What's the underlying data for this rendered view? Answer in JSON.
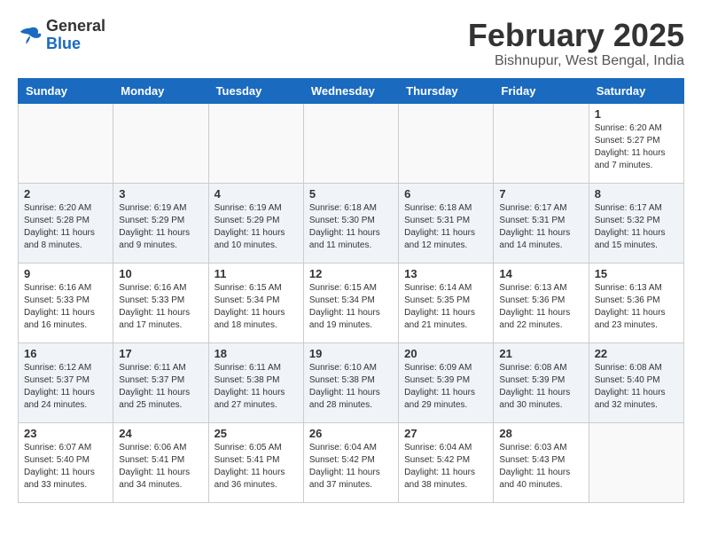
{
  "header": {
    "logo_general": "General",
    "logo_blue": "Blue",
    "title": "February 2025",
    "subtitle": "Bishnupur, West Bengal, India"
  },
  "calendar": {
    "days_of_week": [
      "Sunday",
      "Monday",
      "Tuesday",
      "Wednesday",
      "Thursday",
      "Friday",
      "Saturday"
    ],
    "weeks": [
      [
        {
          "day": "",
          "info": ""
        },
        {
          "day": "",
          "info": ""
        },
        {
          "day": "",
          "info": ""
        },
        {
          "day": "",
          "info": ""
        },
        {
          "day": "",
          "info": ""
        },
        {
          "day": "",
          "info": ""
        },
        {
          "day": "1",
          "info": "Sunrise: 6:20 AM\nSunset: 5:27 PM\nDaylight: 11 hours and 7 minutes."
        }
      ],
      [
        {
          "day": "2",
          "info": "Sunrise: 6:20 AM\nSunset: 5:28 PM\nDaylight: 11 hours and 8 minutes."
        },
        {
          "day": "3",
          "info": "Sunrise: 6:19 AM\nSunset: 5:29 PM\nDaylight: 11 hours and 9 minutes."
        },
        {
          "day": "4",
          "info": "Sunrise: 6:19 AM\nSunset: 5:29 PM\nDaylight: 11 hours and 10 minutes."
        },
        {
          "day": "5",
          "info": "Sunrise: 6:18 AM\nSunset: 5:30 PM\nDaylight: 11 hours and 11 minutes."
        },
        {
          "day": "6",
          "info": "Sunrise: 6:18 AM\nSunset: 5:31 PM\nDaylight: 11 hours and 12 minutes."
        },
        {
          "day": "7",
          "info": "Sunrise: 6:17 AM\nSunset: 5:31 PM\nDaylight: 11 hours and 14 minutes."
        },
        {
          "day": "8",
          "info": "Sunrise: 6:17 AM\nSunset: 5:32 PM\nDaylight: 11 hours and 15 minutes."
        }
      ],
      [
        {
          "day": "9",
          "info": "Sunrise: 6:16 AM\nSunset: 5:33 PM\nDaylight: 11 hours and 16 minutes."
        },
        {
          "day": "10",
          "info": "Sunrise: 6:16 AM\nSunset: 5:33 PM\nDaylight: 11 hours and 17 minutes."
        },
        {
          "day": "11",
          "info": "Sunrise: 6:15 AM\nSunset: 5:34 PM\nDaylight: 11 hours and 18 minutes."
        },
        {
          "day": "12",
          "info": "Sunrise: 6:15 AM\nSunset: 5:34 PM\nDaylight: 11 hours and 19 minutes."
        },
        {
          "day": "13",
          "info": "Sunrise: 6:14 AM\nSunset: 5:35 PM\nDaylight: 11 hours and 21 minutes."
        },
        {
          "day": "14",
          "info": "Sunrise: 6:13 AM\nSunset: 5:36 PM\nDaylight: 11 hours and 22 minutes."
        },
        {
          "day": "15",
          "info": "Sunrise: 6:13 AM\nSunset: 5:36 PM\nDaylight: 11 hours and 23 minutes."
        }
      ],
      [
        {
          "day": "16",
          "info": "Sunrise: 6:12 AM\nSunset: 5:37 PM\nDaylight: 11 hours and 24 minutes."
        },
        {
          "day": "17",
          "info": "Sunrise: 6:11 AM\nSunset: 5:37 PM\nDaylight: 11 hours and 25 minutes."
        },
        {
          "day": "18",
          "info": "Sunrise: 6:11 AM\nSunset: 5:38 PM\nDaylight: 11 hours and 27 minutes."
        },
        {
          "day": "19",
          "info": "Sunrise: 6:10 AM\nSunset: 5:38 PM\nDaylight: 11 hours and 28 minutes."
        },
        {
          "day": "20",
          "info": "Sunrise: 6:09 AM\nSunset: 5:39 PM\nDaylight: 11 hours and 29 minutes."
        },
        {
          "day": "21",
          "info": "Sunrise: 6:08 AM\nSunset: 5:39 PM\nDaylight: 11 hours and 30 minutes."
        },
        {
          "day": "22",
          "info": "Sunrise: 6:08 AM\nSunset: 5:40 PM\nDaylight: 11 hours and 32 minutes."
        }
      ],
      [
        {
          "day": "23",
          "info": "Sunrise: 6:07 AM\nSunset: 5:40 PM\nDaylight: 11 hours and 33 minutes."
        },
        {
          "day": "24",
          "info": "Sunrise: 6:06 AM\nSunset: 5:41 PM\nDaylight: 11 hours and 34 minutes."
        },
        {
          "day": "25",
          "info": "Sunrise: 6:05 AM\nSunset: 5:41 PM\nDaylight: 11 hours and 36 minutes."
        },
        {
          "day": "26",
          "info": "Sunrise: 6:04 AM\nSunset: 5:42 PM\nDaylight: 11 hours and 37 minutes."
        },
        {
          "day": "27",
          "info": "Sunrise: 6:04 AM\nSunset: 5:42 PM\nDaylight: 11 hours and 38 minutes."
        },
        {
          "day": "28",
          "info": "Sunrise: 6:03 AM\nSunset: 5:43 PM\nDaylight: 11 hours and 40 minutes."
        },
        {
          "day": "",
          "info": ""
        }
      ]
    ]
  }
}
